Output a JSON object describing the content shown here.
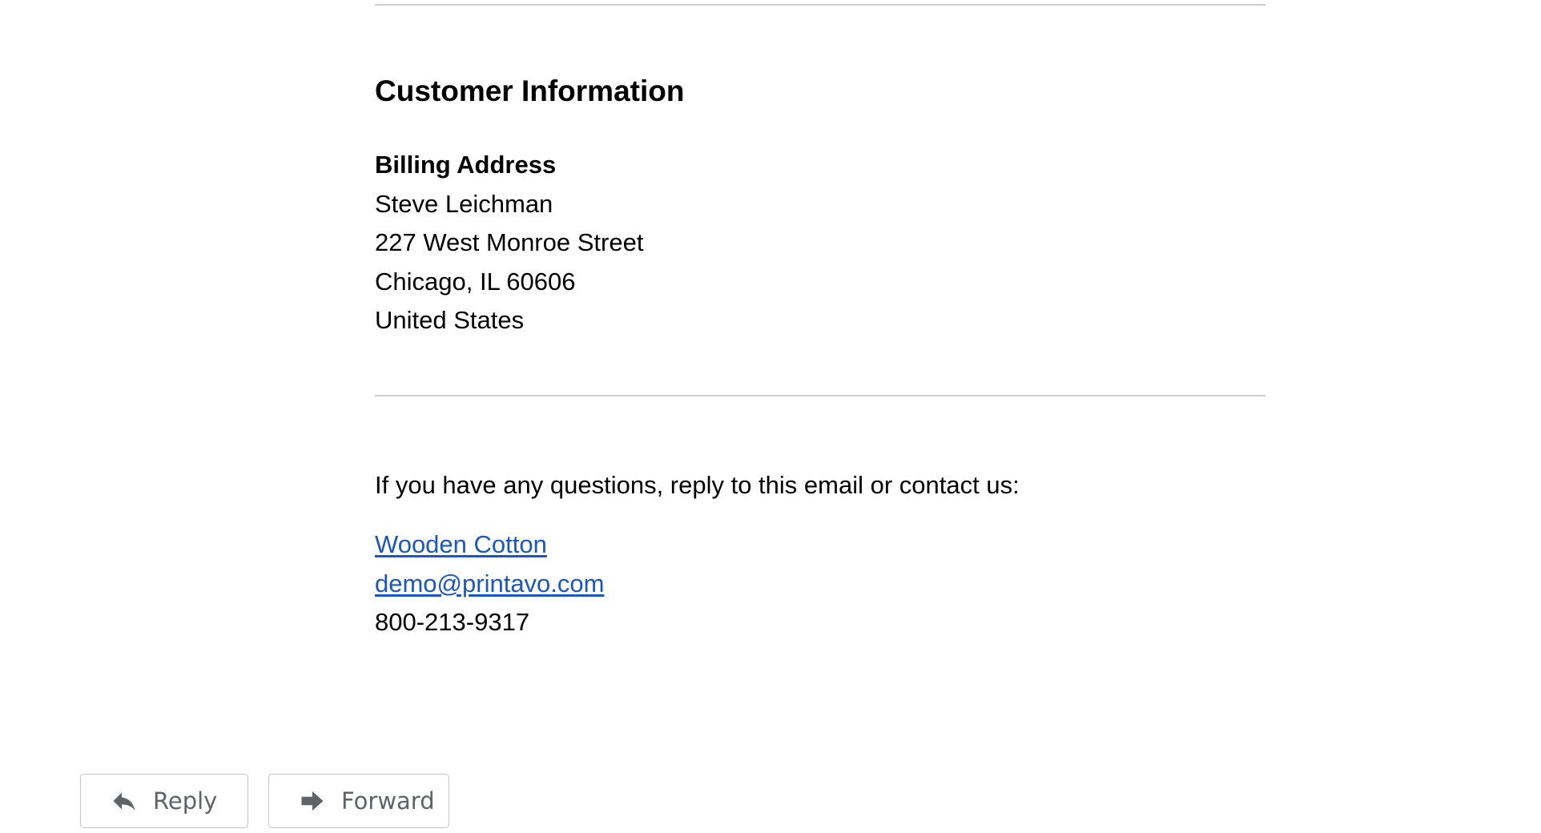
{
  "customer_info": {
    "title": "Customer Information",
    "billing": {
      "label": "Billing Address",
      "name": "Steve Leichman",
      "street": "227 West Monroe Street",
      "city_line": "Chicago, IL 60606",
      "country": "United States"
    }
  },
  "contact": {
    "intro": "If you have any questions, reply to this email or contact us:",
    "company_link": "Wooden Cotton",
    "email_link": "demo@printavo.com",
    "phone": "800-213-9317"
  },
  "actions": {
    "reply_label": "Reply",
    "reply_icon": "reply-icon",
    "forward_label": "Forward",
    "forward_icon": "forward-icon"
  },
  "colors": {
    "link": "#1a56c4",
    "button_text": "#5f6368",
    "divider": "#cfcfcf"
  }
}
